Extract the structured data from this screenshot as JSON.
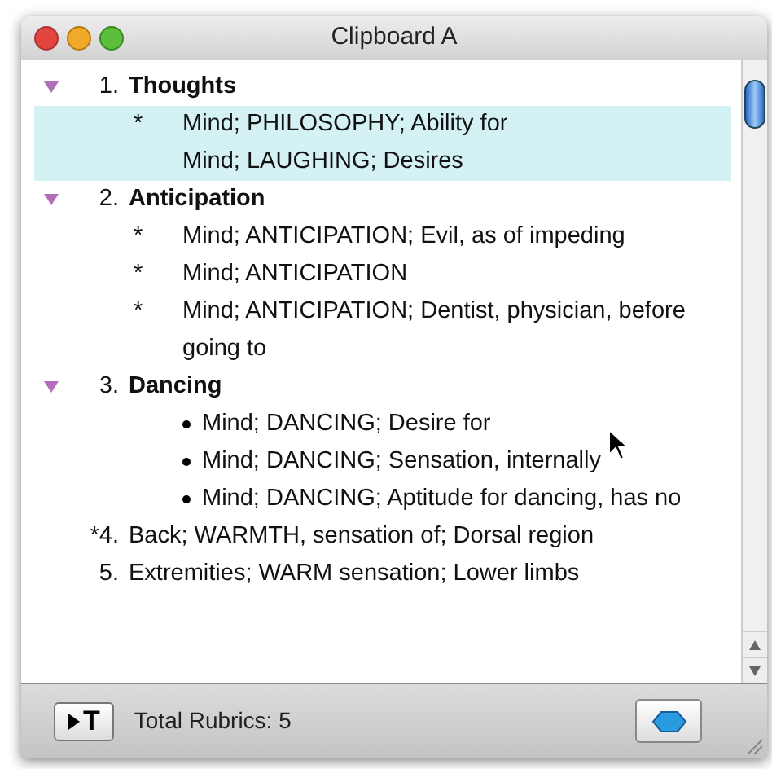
{
  "window": {
    "title": "Clipboard A"
  },
  "rubrics": [
    {
      "number": "1.",
      "title": "Thoughts",
      "kind": "group",
      "expanded": true,
      "entries": [
        {
          "kind": "marked",
          "marker": "*",
          "text": "Mind; PHILOSOPHY; Ability for",
          "selected": true
        },
        {
          "kind": "plain",
          "text": "Mind; LAUGHING; Desires",
          "selected": true
        }
      ]
    },
    {
      "number": "2.",
      "title": "Anticipation",
      "kind": "group",
      "expanded": true,
      "entries": [
        {
          "kind": "marked",
          "marker": "*",
          "text": "Mind; ANTICIPATION; Evil, as of impeding",
          "selected": false
        },
        {
          "kind": "marked",
          "marker": "*",
          "text": "Mind; ANTICIPATION",
          "selected": false
        },
        {
          "kind": "marked",
          "marker": "*",
          "text": "Mind; ANTICIPATION; Dentist, physician, before going to",
          "selected": false
        }
      ]
    },
    {
      "number": "3.",
      "title": "Dancing",
      "kind": "group",
      "expanded": true,
      "entries": [
        {
          "kind": "bullet",
          "text": "Mind; DANCING; Desire for",
          "selected": false
        },
        {
          "kind": "bullet",
          "text": "Mind; DANCING; Sensation, internally",
          "selected": false
        },
        {
          "kind": "bullet",
          "text": "Mind; DANCING; Aptitude for dancing, has no",
          "selected": false
        }
      ]
    },
    {
      "number": "*4.",
      "title": "Back; WARMTH, sensation of; Dorsal region",
      "kind": "rubric"
    },
    {
      "number": "5.",
      "title": "Extremities; WARM sensation; Lower limbs",
      "kind": "rubric"
    }
  ],
  "status_bar": {
    "button": "T",
    "text": "Total Rubrics: 5"
  }
}
